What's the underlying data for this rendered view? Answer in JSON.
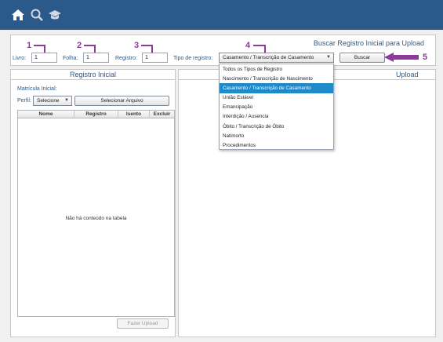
{
  "topbar": {
    "icons": [
      "home-icon",
      "search-icon",
      "graduation-cap-icon"
    ]
  },
  "search": {
    "title": "Buscar Registro Inicial para Upload",
    "livro_label": "Livro:",
    "livro_value": "1",
    "folha_label": "Folha:",
    "folha_value": "1",
    "registro_label": "Registro:",
    "registro_value": "1",
    "tipo_label": "Tipo de registro:",
    "tipo_value": "Casamento / Transcrição de Casamento",
    "buscar_label": "Buscar"
  },
  "dropdown": {
    "options": [
      "Todos os Tipos de Registro",
      "Nascimento / Transcrição de Nascimento",
      "Casamento / Transcrição de Casamento",
      "União Estável",
      "Emancipação",
      "Interdição / Ausencia",
      "Óbito / Transcrição de Óbito",
      "Natimorto",
      "Procedimentos"
    ],
    "selected_index": 2
  },
  "markers": [
    "1",
    "2",
    "3",
    "4",
    "5"
  ],
  "left_panel": {
    "title": "Registro Inicial",
    "matricula_label": "Matrícula Inicial:",
    "perfil_label": "Perfil:",
    "perfil_value": "Selecione",
    "selecionar_label": "Selecionar Arquivo",
    "columns": [
      "Nome",
      "Registro",
      "Isento",
      "Excluir"
    ],
    "empty_text": "Não há conteúdo na tabela",
    "upload_label": "Fazer Upload"
  },
  "right_panel": {
    "title": "Upload"
  },
  "colors": {
    "topbar": "#2b5a8a",
    "accent_purple": "#8d3a9a",
    "selection_blue": "#1e8ac9"
  }
}
